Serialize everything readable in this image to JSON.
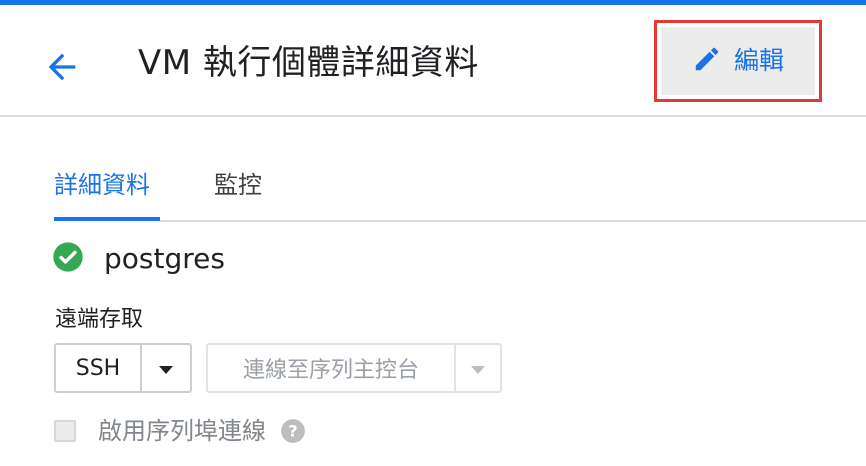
{
  "colors": {
    "accent": "#1a73e8",
    "top_bar": "#1a73e8",
    "highlight_border": "#e53935",
    "status_ok": "#34a853"
  },
  "header": {
    "title": "VM 執行個體詳細資料",
    "back_icon": "arrow-back-icon",
    "edit": {
      "label": "編輯",
      "icon": "pencil-icon"
    }
  },
  "tabs": [
    {
      "label": "詳細資料",
      "active": true
    },
    {
      "label": "監控",
      "active": false
    }
  ],
  "instance": {
    "name": "postgres",
    "status_icon": "check-circle-icon"
  },
  "remote_access": {
    "label": "遠端存取",
    "ssh_label": "SSH",
    "serial_console_label": "連線至序列主控台",
    "dropdown_icon": "caret-down-icon"
  },
  "serial_port": {
    "checkbox_label": "啟用序列埠連線",
    "checked": false,
    "help_icon": "help-icon"
  }
}
